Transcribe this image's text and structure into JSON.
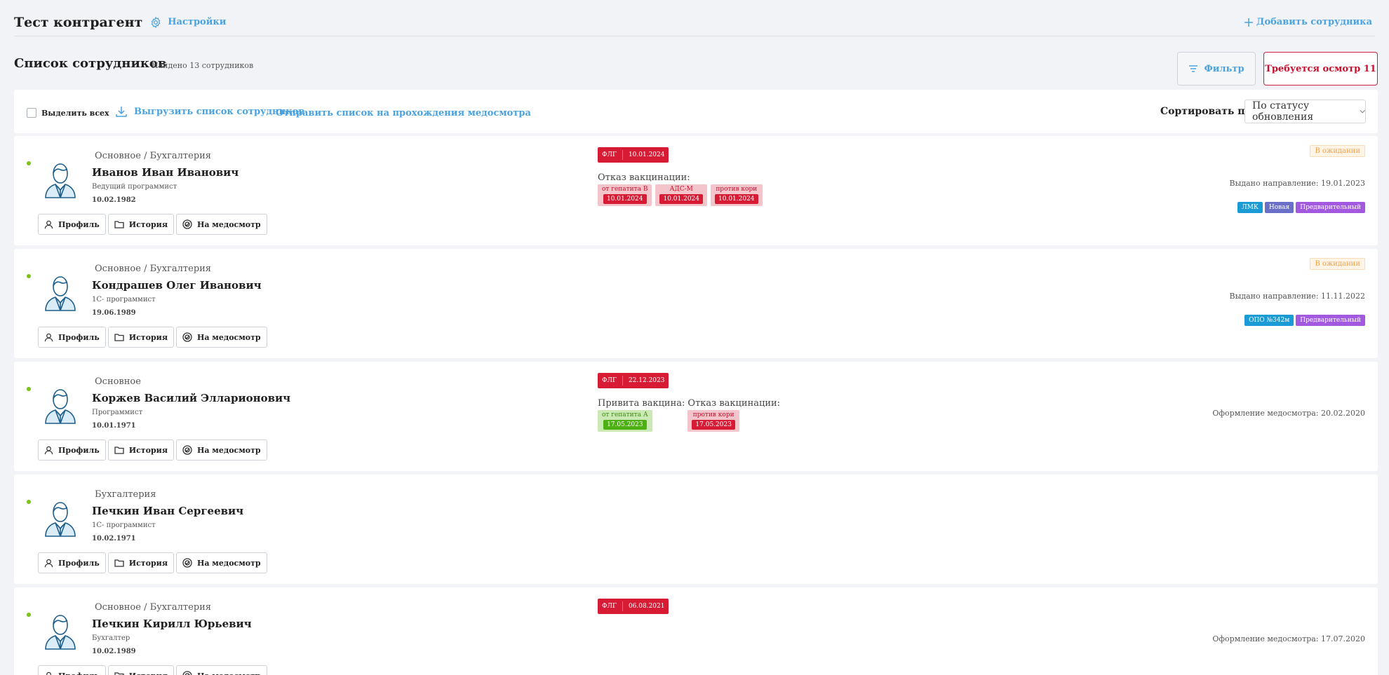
{
  "header": {
    "company": "Тест контрагент",
    "settings_label": "Настройки",
    "add_employee_label": "Добавить сотрудника"
  },
  "list": {
    "title": "Список сотрудников",
    "found_text": "Найдено 13 сотрудников",
    "filter_label": "Фильтр",
    "required_exam_label": "Требуется осмотр 11"
  },
  "toolbar": {
    "select_all_label": "Выделить всех",
    "export_label": "Выгрузить список сотрудников",
    "send_label": "Отправить список на прохождения медосмотра",
    "sort_label": "Сортировать по",
    "sort_value": "По статусу обновления"
  },
  "actions": {
    "profile": "Профиль",
    "history": "История",
    "medical": "На медосмотр"
  },
  "employees": [
    {
      "dept": "Основное / Бухгалтерия",
      "name": "Иванов Иван Иванович",
      "position": "Ведущий программист",
      "dob": "10.02.1982",
      "flg_label": "ФЛГ",
      "flg_date": "10.01.2024",
      "refuse_title": "Отказ вакцинации:",
      "refuse_chips": [
        {
          "name": "от гепатита В",
          "date": "10.01.2024"
        },
        {
          "name": "АДС-М",
          "date": "10.01.2024"
        },
        {
          "name": "против кори",
          "date": "10.01.2024"
        }
      ],
      "status": "В ожидании",
      "right_text": "Выдано направление: 19.01.2023",
      "badges": [
        {
          "label": "ЛМК",
          "color": "#1a9bd6"
        },
        {
          "label": "Новая",
          "color": "#6a6fc8"
        },
        {
          "label": "Предварительный",
          "color": "#a259e0"
        }
      ]
    },
    {
      "dept": "Основное / Бухгалтерия",
      "name": "Кондрашев Олег Иванович",
      "position": "1С- программист",
      "dob": "19.06.1989",
      "status": "В ожидании",
      "right_text": "Выдано направление: 11.11.2022",
      "badges": [
        {
          "label": "ОПО №342м",
          "color": "#1a9bd6"
        },
        {
          "label": "Предварительный",
          "color": "#a259e0"
        }
      ]
    },
    {
      "dept": "Основное",
      "name": "Коржев Василий Элларионович",
      "position": "Программист",
      "dob": "10.01.1971",
      "flg_label": "ФЛГ",
      "flg_date": "22.12.2023",
      "vaccinated_title": "Привита вакцина:",
      "vaccinated_chips": [
        {
          "name": "от гепатита А",
          "date": "17.05.2023"
        }
      ],
      "refuse_title": "Отказ вакцинации:",
      "refuse_chips": [
        {
          "name": "против кори",
          "date": "17.05.2023"
        }
      ],
      "right_text": "Оформление медосмотра: 20.02.2020"
    },
    {
      "dept": "Бухгалтерия",
      "name": "Печкин Иван Сергеевич",
      "position": "1С- программист",
      "dob": "10.02.1971"
    },
    {
      "dept": "Основное / Бухгалтерия",
      "name": "Печкин Кирилл Юрьевич",
      "position": "Бухгалтер",
      "dob": "10.02.1989",
      "flg_label": "ФЛГ",
      "flg_date": "06.08.2021",
      "right_text": "Оформление медосмотра: 17.07.2020"
    }
  ],
  "colors": {
    "accent": "#4aa3e0",
    "danger": "#d81b35",
    "online": "#7ac31a"
  }
}
